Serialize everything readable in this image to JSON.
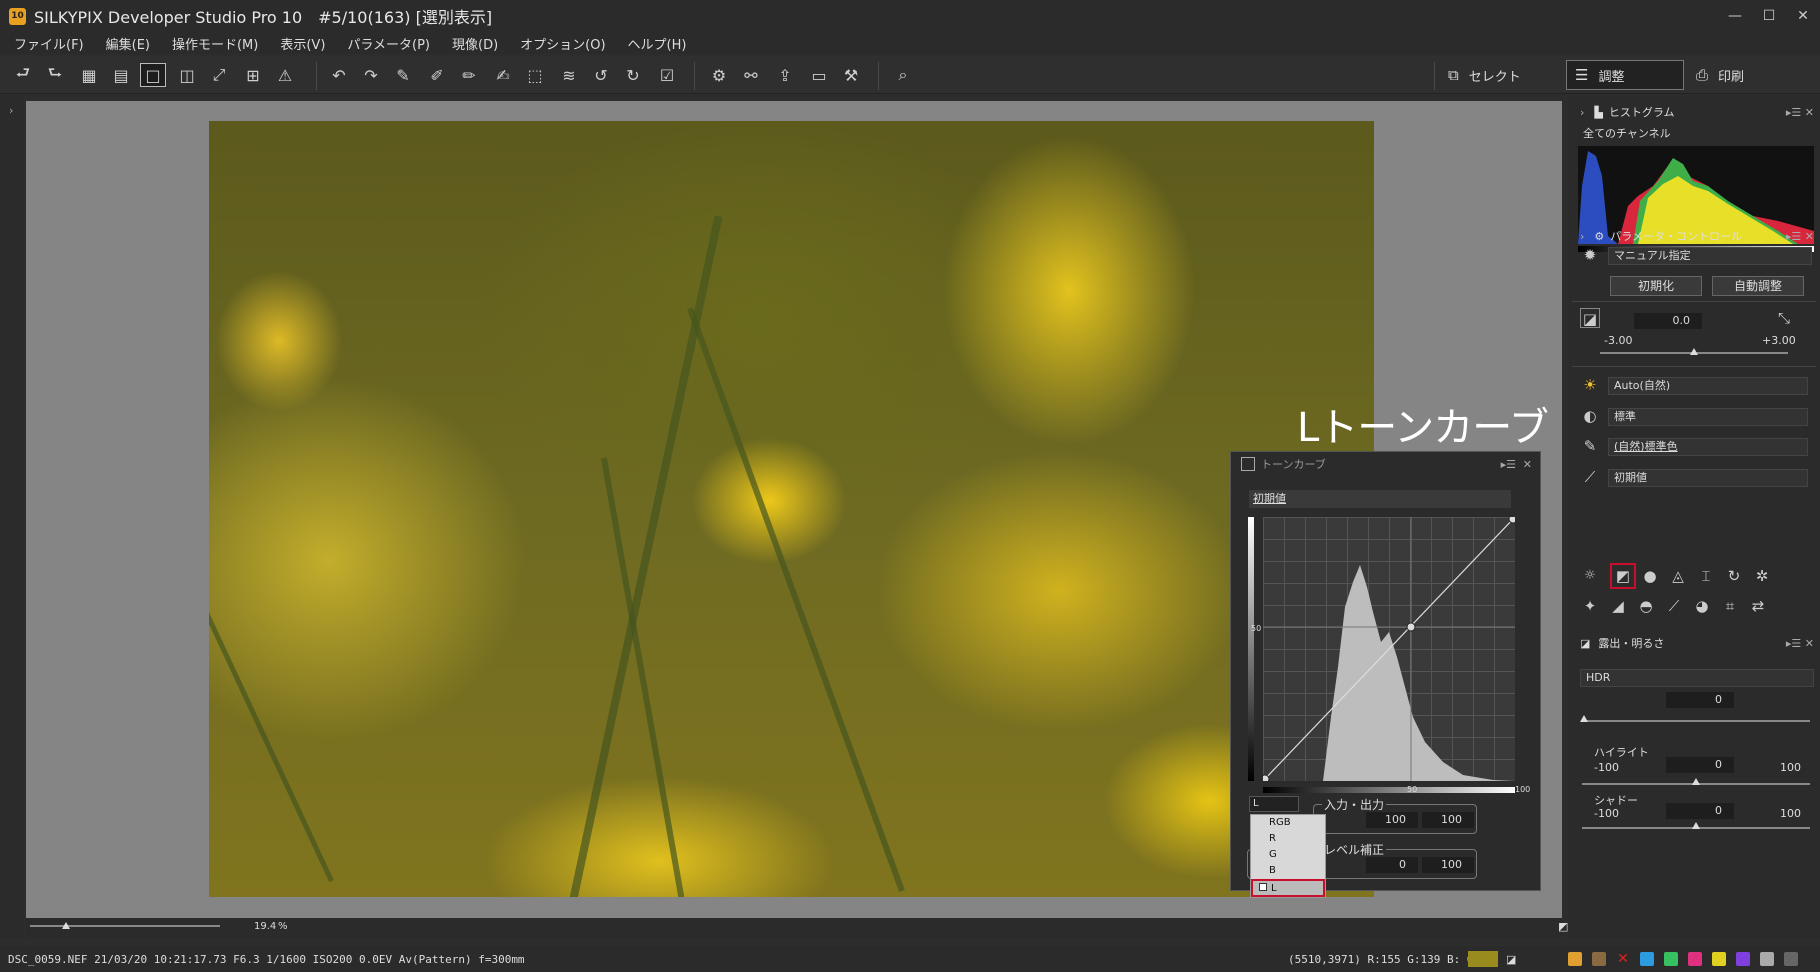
{
  "window": {
    "icon_text": "10",
    "title": "SILKYPIX Developer Studio Pro 10　#5/10(163) [選別表示]",
    "controls": [
      "—",
      "☐",
      "✕"
    ]
  },
  "menu": [
    "ファイル(F)",
    "編集(E)",
    "操作モード(M)",
    "表示(V)",
    "パラメータ(P)",
    "現像(D)",
    "オプション(O)",
    "ヘルプ(H)"
  ],
  "modes": {
    "select": "セレクト",
    "adjust": "調整",
    "print": "印刷"
  },
  "caption": "Lトーンカーブ",
  "tone_curve": {
    "title": "トーンカーブ",
    "preset": "初期値",
    "channel": "L",
    "channel_options": [
      "RGB",
      "R",
      "G",
      "B",
      "L"
    ],
    "io_group_label": "入力・出力",
    "io_input": "100",
    "io_output": "100",
    "level_group_label": "レベル補正",
    "level_low": "0",
    "level_high": "100",
    "graph_mid_left": "50",
    "graph_mid_bottom": "50",
    "graph_max_right": "100"
  },
  "histogram": {
    "title": "ヒストグラム",
    "channel": "全てのチャンネル"
  },
  "param_control": {
    "title": "パラメータ・コントロール",
    "mode": "マニュアル指定",
    "reset_label": "初期化",
    "auto_label": "自動調整",
    "exposure_value": "0.0",
    "exposure_min": "-3.00",
    "exposure_max": "+3.00",
    "wb": "Auto(自然)",
    "tone": "標準",
    "color": "(自然)標準色",
    "sharp": "初期値"
  },
  "exposure_panel": {
    "title": "露出・明るさ",
    "hdr_label": "HDR",
    "hdr_value": "0",
    "highlight_label": "ハイライト",
    "highlight_min": "-100",
    "highlight_max": "100",
    "highlight_value": "0",
    "shadow_label": "シャドー",
    "shadow_min": "-100",
    "shadow_max": "100",
    "shadow_value": "0"
  },
  "zoom": {
    "value": "19.4",
    "unit": "%"
  },
  "status": {
    "file_info": "DSC_0059.NEF 21/03/20 10:21:17.73 F6.3 1/1600 ISO200  0.0EV Av(Pattern) f=300mm",
    "pixel_info": "(5510,3971) R:155 G:139 B:  0",
    "pixel_color": "#9a8b1f"
  },
  "colors": {
    "accent_red": "#c8102e",
    "bg": "#2b2b2b"
  }
}
